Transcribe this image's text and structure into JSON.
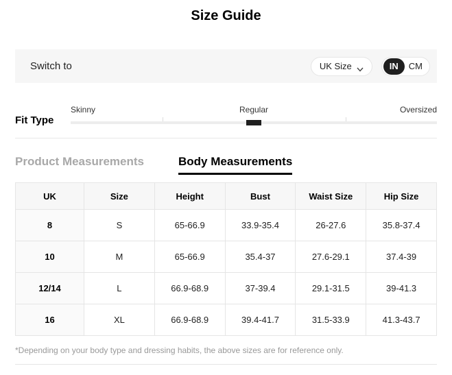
{
  "title": "Size Guide",
  "switch_bar": {
    "label": "Switch to",
    "size_standard": {
      "selected": "UK Size"
    },
    "unit_toggle": {
      "options": [
        "IN",
        "CM"
      ],
      "selected": "IN"
    }
  },
  "fit_type": {
    "label": "Fit Type",
    "options": [
      "Skinny",
      "Regular",
      "Oversized"
    ],
    "selected": "Regular"
  },
  "tabs": {
    "product": {
      "label": "Product Measurements",
      "active": false
    },
    "body": {
      "label": "Body Measurements",
      "active": true
    }
  },
  "size_table": {
    "headers": [
      "UK",
      "Size",
      "Height",
      "Bust",
      "Waist Size",
      "Hip Size"
    ],
    "rows": [
      [
        "8",
        "S",
        "65-66.9",
        "33.9-35.4",
        "26-27.6",
        "35.8-37.4"
      ],
      [
        "10",
        "M",
        "65-66.9",
        "35.4-37",
        "27.6-29.1",
        "37.4-39"
      ],
      [
        "12/14",
        "L",
        "66.9-68.9",
        "37-39.4",
        "29.1-31.5",
        "39-41.3"
      ],
      [
        "16",
        "XL",
        "66.9-68.9",
        "39.4-41.7",
        "31.5-33.9",
        "41.3-43.7"
      ]
    ]
  },
  "footnote": "*Depending on your body type and dressing habits, the above sizes are for reference only.",
  "colors": {
    "accent_dark": "#1f1f1f",
    "bar_background": "#f6f6f6",
    "border_light": "#e5e5e5",
    "inactive_tab": "#a8a8a8",
    "footnote_gray": "#999999"
  }
}
